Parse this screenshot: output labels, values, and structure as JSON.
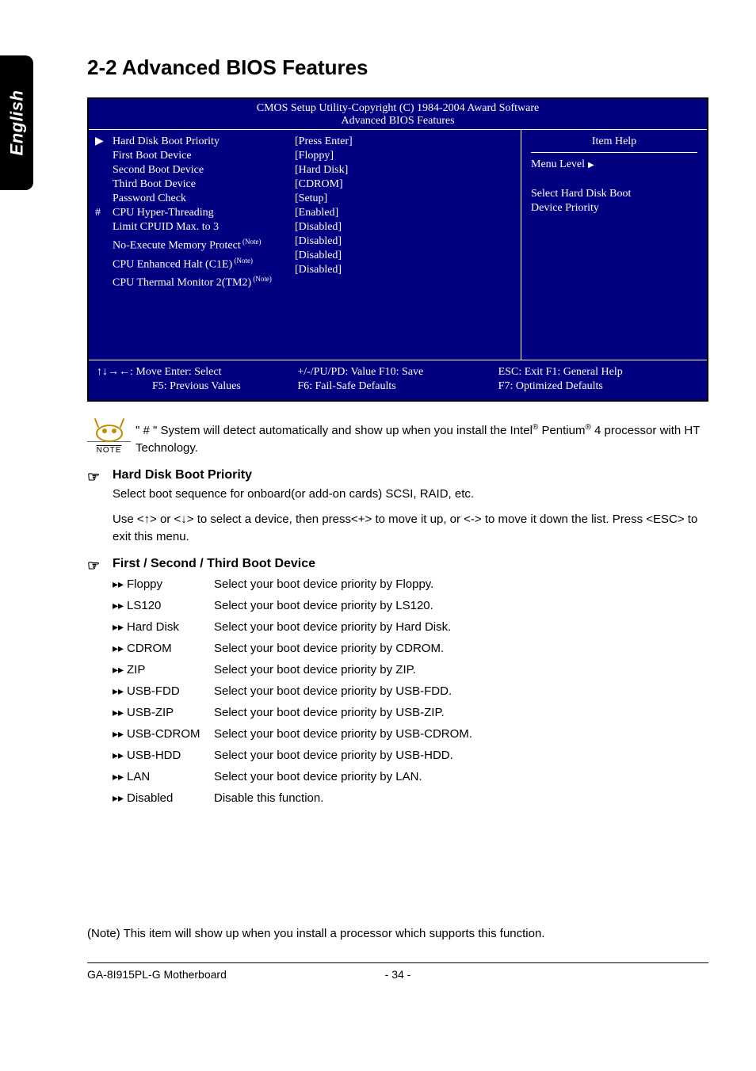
{
  "side_tab": "English",
  "title": "2-2   Advanced BIOS Features",
  "bios": {
    "header_line": "CMOS Setup Utility-Copyright (C) 1984-2004 Award Software",
    "subtitle": "Advanced BIOS Features",
    "items": [
      {
        "marker": "▶",
        "label": "Hard Disk Boot Priority",
        "value": "[Press Enter]",
        "note": false
      },
      {
        "marker": "",
        "label": "First Boot Device",
        "value": "[Floppy]",
        "note": false
      },
      {
        "marker": "",
        "label": "Second Boot Device",
        "value": "[Hard Disk]",
        "note": false
      },
      {
        "marker": "",
        "label": "Third Boot Device",
        "value": "[CDROM]",
        "note": false
      },
      {
        "marker": "",
        "label": "Password Check",
        "value": "[Setup]",
        "note": false
      },
      {
        "marker": "#",
        "label": "CPU Hyper-Threading",
        "value": "[Enabled]",
        "note": false
      },
      {
        "marker": "",
        "label": "Limit CPUID Max. to 3",
        "value": "[Disabled]",
        "note": false
      },
      {
        "marker": "",
        "label": "No-Execute Memory Protect",
        "value": "[Disabled]",
        "note": true
      },
      {
        "marker": "",
        "label": "CPU Enhanced Halt (C1E)",
        "value": "[Disabled]",
        "note": true
      },
      {
        "marker": "",
        "label": "CPU Thermal Monitor 2(TM2)",
        "value": "[Disabled]",
        "note": true
      }
    ],
    "help": {
      "title": "Item Help",
      "menu_level": "Menu Level",
      "line1": "Select Hard Disk Boot",
      "line2": "Device Priority"
    },
    "footer": {
      "c1a": "↑↓→←: Move      Enter: Select",
      "c1b": "F5: Previous Values",
      "c2a": "+/-/PU/PD: Value          F10: Save",
      "c2b": "F6: Fail-Safe Defaults",
      "c3a": "ESC: Exit       F1: General Help",
      "c3b": "F7: Optimized Defaults"
    },
    "note_super": "(Note)"
  },
  "note_text_pre": "\" # \" System will detect automatically and show up when you install the Intel",
  "note_text_mid": " Pentium",
  "note_text_post": " 4 processor with HT Technology.",
  "sections": [
    {
      "title": "Hard Disk Boot Priority",
      "paras": [
        "Select boot sequence for onboard(or add-on cards) SCSI, RAID, etc.",
        "Use <↑> or <↓> to select a device, then press<+> to move it up, or <-> to move it down the list. Press <ESC> to exit this menu."
      ],
      "options": []
    },
    {
      "title": "First / Second / Third Boot Device",
      "paras": [],
      "options": [
        {
          "name": "Floppy",
          "desc": "Select your boot device priority by Floppy."
        },
        {
          "name": "LS120",
          "desc": "Select your boot device priority by LS120."
        },
        {
          "name": "Hard Disk",
          "desc": "Select your boot device priority by Hard Disk."
        },
        {
          "name": "CDROM",
          "desc": "Select your boot device priority by CDROM."
        },
        {
          "name": "ZIP",
          "desc": "Select your boot device priority by ZIP."
        },
        {
          "name": "USB-FDD",
          "desc": "Select your boot device priority by USB-FDD."
        },
        {
          "name": "USB-ZIP",
          "desc": "Select your boot device priority by USB-ZIP."
        },
        {
          "name": "USB-CDROM",
          "desc": "Select your boot device priority by USB-CDROM."
        },
        {
          "name": "USB-HDD",
          "desc": "Select your boot device priority by USB-HDD."
        },
        {
          "name": "LAN",
          "desc": "Select your boot device priority by LAN."
        },
        {
          "name": "Disabled",
          "desc": "Disable this function."
        }
      ]
    }
  ],
  "foot_note": "(Note)   This item will show up when you install a processor which supports this function.",
  "footer_left": "GA-8I915PL-G Motherboard",
  "footer_page": "- 34 -",
  "option_marker": "▸▸",
  "hand": "☞"
}
